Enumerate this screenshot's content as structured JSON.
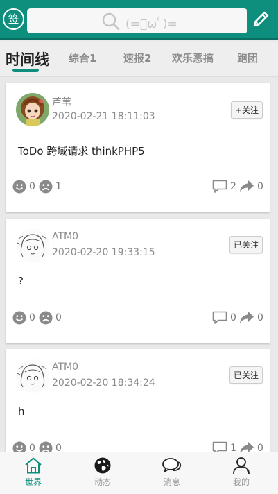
{
  "header": {
    "checkin_label": "签",
    "search_placeholder": "(=ﾟωﾟ)=",
    "accent_color": "#0e8f7e"
  },
  "tabs": [
    {
      "label": "时间线",
      "active": true
    },
    {
      "label": "综合1",
      "active": false
    },
    {
      "label": "速报2",
      "active": false
    },
    {
      "label": "欢乐恶搞",
      "active": false
    },
    {
      "label": "跑团",
      "active": false
    }
  ],
  "posts": [
    {
      "username": "芦苇",
      "time": "2020-02-21 18:11:03",
      "follow_label": "+关注",
      "content": "ToDo 跨域请求 thinkPHP5",
      "likes": "0",
      "dislikes": "1",
      "comments": "2",
      "shares": "0",
      "avatar": "anime-girl-color"
    },
    {
      "username": "ATM0",
      "time": "2020-02-20 19:33:15",
      "follow_label": "已关注",
      "content": "?",
      "likes": "0",
      "dislikes": "0",
      "comments": "0",
      "shares": "0",
      "avatar": "sketch-girl"
    },
    {
      "username": "ATM0",
      "time": "2020-02-20 18:34:24",
      "follow_label": "已关注",
      "content": "h",
      "likes": "0",
      "dislikes": "0",
      "comments": "1",
      "shares": "0",
      "avatar": "sketch-girl"
    }
  ],
  "bottom_nav": [
    {
      "label": "世界",
      "icon": "home-icon",
      "active": true
    },
    {
      "label": "动态",
      "icon": "globe-icon",
      "active": false
    },
    {
      "label": "消息",
      "icon": "chat-icon",
      "active": false
    },
    {
      "label": "我的",
      "icon": "user-icon",
      "active": false
    }
  ]
}
